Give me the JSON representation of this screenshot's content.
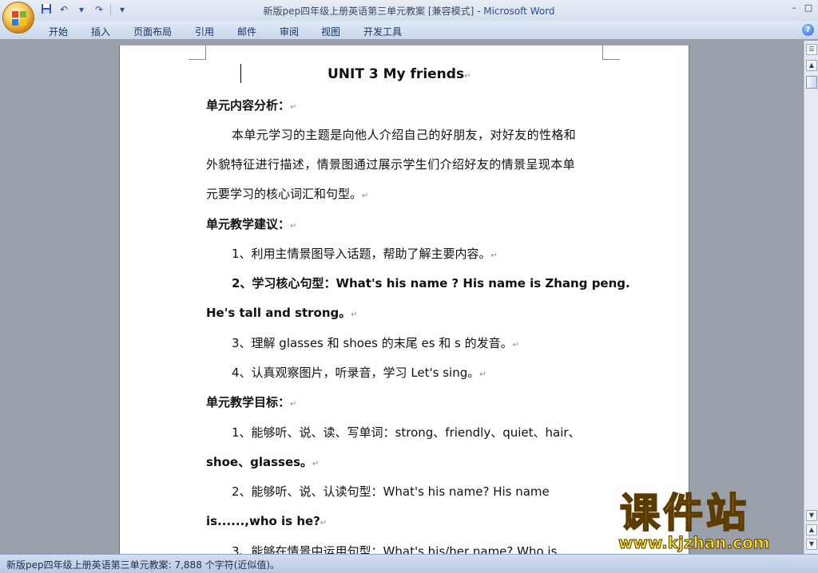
{
  "window": {
    "title": "新版pep四年级上册英语第三单元教案 [兼容模式] - ",
    "app_name": "Microsoft Word",
    "minimize_glyph": "–",
    "restore_glyph": "□",
    "close_glyph": "✕"
  },
  "quick_access": {
    "save_icon": "save-icon",
    "undo_glyph": "↶",
    "redo_glyph": "↷",
    "customize_glyph": "▾"
  },
  "ribbon": {
    "tabs": [
      "开始",
      "插入",
      "页面布局",
      "引用",
      "邮件",
      "审阅",
      "视图",
      "开发工具"
    ],
    "help_glyph": "?"
  },
  "document": {
    "title": "UNIT 3    My friends",
    "lines": [
      "单元内容分析：",
      "本单元学习的主题是向他人介绍自己的好朋友，对好友的性格和",
      "外貌特征进行描述，情景图通过展示学生们介绍好友的情景呈现本单",
      "元要学习的核心词汇和句型。",
      "单元教学建议：",
      "1、利用主情景图导入话题，帮助了解主要内容。",
      "2、学习核心句型：What's his name ? His name is Zhang peng.",
      "He's tall and strong。",
      "3、理解 glasses 和 shoes 的末尾 es 和 s 的发音。",
      "4、认真观察图片，听录音，学习 Let's sing。",
      "单元教学目标：",
      "1、能够听、说、读、写单词：strong、friendly、quiet、hair、",
      "shoe、glasses。",
      "2、能够听、说、认读句型：What's his name? His name",
      "is......,who is he?",
      "3、能够在情景中运用句型：What's his/her name? Who is"
    ],
    "para_mark": "↵"
  },
  "status_bar": {
    "text": "新版pep四年级上册英语第三单元教案: 7,888 个字符(近似值)。"
  },
  "scrollbar": {
    "up_glyph": "▲",
    "down_glyph": "▼",
    "ruler_glyph": "☰"
  },
  "watermark": {
    "brand": "课件站",
    "url": "www.kjzhan.com"
  }
}
